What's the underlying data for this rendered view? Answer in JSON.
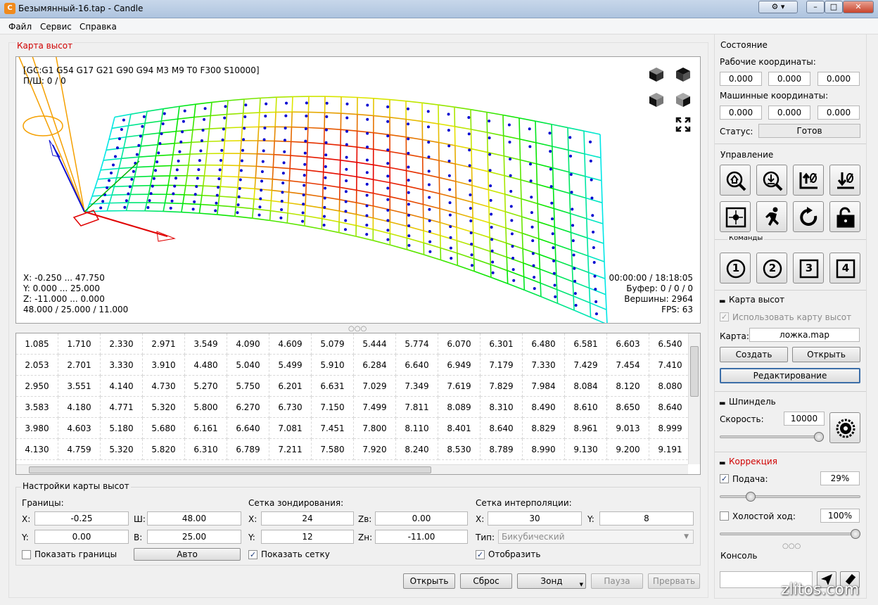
{
  "window": {
    "title": "Безымянный-16.tap - Candle",
    "app_icon": "candle-app-icon"
  },
  "menu": [
    "Файл",
    "Сервис",
    "Справка"
  ],
  "heightmap_group": {
    "title": "Карта высот"
  },
  "viewer": {
    "gcode_state": "[GC:G1 G54 G17 G21 G90 G94 M3 M9 T0 F300 S10000]",
    "ps_line": "П/Ш: 0 / 0",
    "bounds": [
      "X: -0.250 ... 47.750",
      "Y: 0.000 ... 25.000",
      "Z: -11.000 ... 0.000",
      "48.000 / 25.000 / 11.000"
    ],
    "stats": [
      "00:00:00 / 18:18:05",
      "Буфер: 0 / 0 / 0",
      "Вершины: 2964",
      "FPS: 63"
    ],
    "view_buttons": [
      "cube-front-icon",
      "cube-top-icon",
      "cube-left-icon",
      "cube-iso-icon",
      "fit-view-icon"
    ]
  },
  "table_rows": [
    [
      "1.085",
      "1.710",
      "2.330",
      "2.971",
      "3.549",
      "4.090",
      "4.609",
      "5.079",
      "5.444",
      "5.774",
      "6.070",
      "6.301",
      "6.480",
      "6.581",
      "6.603",
      "6.540"
    ],
    [
      "2.053",
      "2.701",
      "3.330",
      "3.910",
      "4.480",
      "5.040",
      "5.499",
      "5.910",
      "6.284",
      "6.640",
      "6.949",
      "7.179",
      "7.330",
      "7.429",
      "7.454",
      "7.410"
    ],
    [
      "2.950",
      "3.551",
      "4.140",
      "4.730",
      "5.270",
      "5.750",
      "6.201",
      "6.631",
      "7.029",
      "7.349",
      "7.619",
      "7.829",
      "7.984",
      "8.084",
      "8.120",
      "8.080"
    ],
    [
      "3.583",
      "4.180",
      "4.771",
      "5.320",
      "5.800",
      "6.270",
      "6.730",
      "7.150",
      "7.499",
      "7.811",
      "8.089",
      "8.310",
      "8.490",
      "8.610",
      "8.650",
      "8.640"
    ],
    [
      "3.980",
      "4.603",
      "5.180",
      "5.680",
      "6.161",
      "6.640",
      "7.081",
      "7.451",
      "7.800",
      "8.110",
      "8.401",
      "8.640",
      "8.829",
      "8.961",
      "9.013",
      "8.999"
    ],
    [
      "4.130",
      "4.759",
      "5.320",
      "5.820",
      "6.310",
      "6.789",
      "7.211",
      "7.580",
      "7.920",
      "8.240",
      "8.530",
      "8.789",
      "8.990",
      "9.130",
      "9.200",
      "9.191"
    ]
  ],
  "settings": {
    "title": "Настройки карты высот",
    "bounds": {
      "label": "Границы:",
      "x_label": "X:",
      "x": "-0.25",
      "w_label": "Ш:",
      "w": "48.00",
      "y_label": "Y:",
      "y": "0.00",
      "h_label": "В:",
      "h": "25.00",
      "show_label": "Показать границы",
      "auto": "Авто"
    },
    "probe": {
      "label": "Сетка зондирования:",
      "x_label": "X:",
      "x": "24",
      "zb_label": "Zв:",
      "zb": "0.00",
      "y_label": "Y:",
      "y": "12",
      "zh_label": "Zн:",
      "zh": "-11.00",
      "show_label": "Показать сетку"
    },
    "interp": {
      "label": "Сетка интерполяции:",
      "x_label": "X:",
      "x": "30",
      "y_label": "Y:",
      "y": "8",
      "type_label": "Тип:",
      "type": "Бикубический",
      "show_label": "Отобразить"
    }
  },
  "bottom_buttons": {
    "open": "Открыть",
    "reset": "Сброс",
    "probe": "Зонд",
    "pause": "Пауза",
    "abort": "Прервать"
  },
  "state": {
    "title": "Состояние",
    "work_label": "Рабочие координаты:",
    "work": [
      "0.000",
      "0.000",
      "0.000"
    ],
    "machine_label": "Машинные координаты:",
    "machine": [
      "0.000",
      "0.000",
      "0.000"
    ],
    "status_label": "Статус:",
    "status": "Готов"
  },
  "control": {
    "title": "Управление",
    "icons": [
      "home-search-icon",
      "probe-z-icon",
      "zero-xy-icon",
      "zero-z-icon",
      "origin-icon",
      "safe-position-icon",
      "reset-icon",
      "unlock-icon"
    ]
  },
  "commands": {
    "title": "Команды",
    "buttons": [
      "1",
      "2",
      "3",
      "4"
    ]
  },
  "heightmap_panel": {
    "title": "Карта высот",
    "use_label": "Использовать карту высот",
    "map_label": "Карта:",
    "map_file": "ложка.map",
    "create": "Создать",
    "open": "Открыть",
    "edit": "Редактирование"
  },
  "spindle": {
    "title": "Шпиндель",
    "speed_label": "Скорость:",
    "speed": "10000",
    "level_pct": 100
  },
  "correction": {
    "title": "Коррекция",
    "feed_label": "Подача:",
    "feed": "29%",
    "feed_level_pct": 20,
    "rapid_label": "Холостой ход:",
    "rapid": "100%",
    "rapid_level_pct": 100
  },
  "console": {
    "title": "Консоль"
  },
  "watermark": "zlitos.com"
}
